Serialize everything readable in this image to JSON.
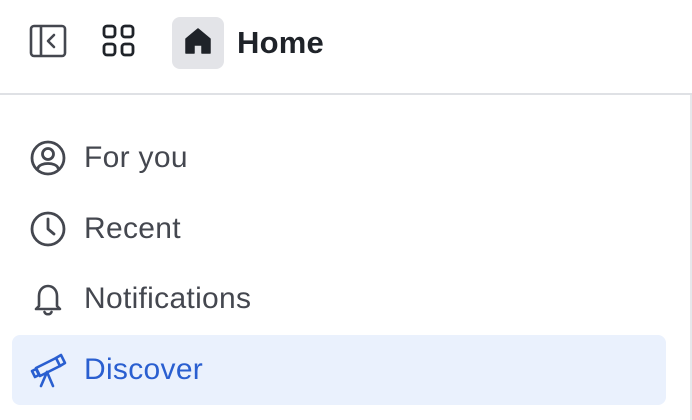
{
  "header": {
    "title": "Home",
    "collapse_icon": "sidebar-collapse-icon",
    "apps_icon": "apps-grid-icon",
    "home_icon": "home-icon"
  },
  "nav": {
    "items": [
      {
        "label": "For you",
        "icon": "user-circle-icon",
        "active": false
      },
      {
        "label": "Recent",
        "icon": "clock-icon",
        "active": false
      },
      {
        "label": "Notifications",
        "icon": "bell-icon",
        "active": false
      },
      {
        "label": "Discover",
        "icon": "telescope-icon",
        "active": true
      }
    ]
  },
  "colors": {
    "accent": "#2a5fd0",
    "active_bg": "#eaf1fd",
    "text": "#44474f",
    "title": "#1f2329",
    "chip_bg": "#e3e4e8"
  }
}
